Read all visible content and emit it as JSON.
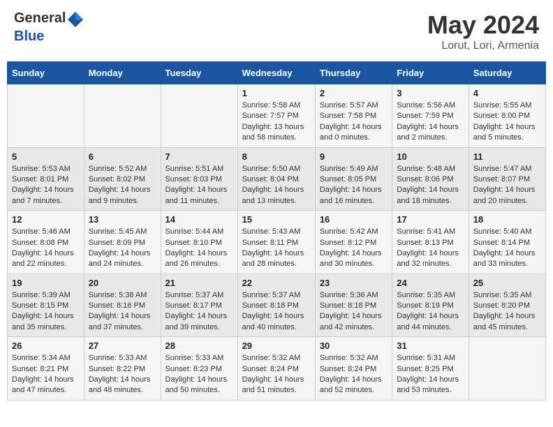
{
  "header": {
    "logo_general": "General",
    "logo_blue": "Blue",
    "title": "May 2024",
    "subtitle": "Lorut, Lori, Armenia"
  },
  "days_of_week": [
    "Sunday",
    "Monday",
    "Tuesday",
    "Wednesday",
    "Thursday",
    "Friday",
    "Saturday"
  ],
  "weeks": [
    {
      "days": [
        {
          "number": "",
          "sunrise": "",
          "sunset": "",
          "daylight": ""
        },
        {
          "number": "",
          "sunrise": "",
          "sunset": "",
          "daylight": ""
        },
        {
          "number": "",
          "sunrise": "",
          "sunset": "",
          "daylight": ""
        },
        {
          "number": "1",
          "sunrise": "Sunrise: 5:58 AM",
          "sunset": "Sunset: 7:57 PM",
          "daylight": "Daylight: 13 hours and 58 minutes."
        },
        {
          "number": "2",
          "sunrise": "Sunrise: 5:57 AM",
          "sunset": "Sunset: 7:58 PM",
          "daylight": "Daylight: 14 hours and 0 minutes."
        },
        {
          "number": "3",
          "sunrise": "Sunrise: 5:56 AM",
          "sunset": "Sunset: 7:59 PM",
          "daylight": "Daylight: 14 hours and 2 minutes."
        },
        {
          "number": "4",
          "sunrise": "Sunrise: 5:55 AM",
          "sunset": "Sunset: 8:00 PM",
          "daylight": "Daylight: 14 hours and 5 minutes."
        }
      ]
    },
    {
      "days": [
        {
          "number": "5",
          "sunrise": "Sunrise: 5:53 AM",
          "sunset": "Sunset: 8:01 PM",
          "daylight": "Daylight: 14 hours and 7 minutes."
        },
        {
          "number": "6",
          "sunrise": "Sunrise: 5:52 AM",
          "sunset": "Sunset: 8:02 PM",
          "daylight": "Daylight: 14 hours and 9 minutes."
        },
        {
          "number": "7",
          "sunrise": "Sunrise: 5:51 AM",
          "sunset": "Sunset: 8:03 PM",
          "daylight": "Daylight: 14 hours and 11 minutes."
        },
        {
          "number": "8",
          "sunrise": "Sunrise: 5:50 AM",
          "sunset": "Sunset: 8:04 PM",
          "daylight": "Daylight: 14 hours and 13 minutes."
        },
        {
          "number": "9",
          "sunrise": "Sunrise: 5:49 AM",
          "sunset": "Sunset: 8:05 PM",
          "daylight": "Daylight: 14 hours and 16 minutes."
        },
        {
          "number": "10",
          "sunrise": "Sunrise: 5:48 AM",
          "sunset": "Sunset: 8:06 PM",
          "daylight": "Daylight: 14 hours and 18 minutes."
        },
        {
          "number": "11",
          "sunrise": "Sunrise: 5:47 AM",
          "sunset": "Sunset: 8:07 PM",
          "daylight": "Daylight: 14 hours and 20 minutes."
        }
      ]
    },
    {
      "days": [
        {
          "number": "12",
          "sunrise": "Sunrise: 5:46 AM",
          "sunset": "Sunset: 8:08 PM",
          "daylight": "Daylight: 14 hours and 22 minutes."
        },
        {
          "number": "13",
          "sunrise": "Sunrise: 5:45 AM",
          "sunset": "Sunset: 8:09 PM",
          "daylight": "Daylight: 14 hours and 24 minutes."
        },
        {
          "number": "14",
          "sunrise": "Sunrise: 5:44 AM",
          "sunset": "Sunset: 8:10 PM",
          "daylight": "Daylight: 14 hours and 26 minutes."
        },
        {
          "number": "15",
          "sunrise": "Sunrise: 5:43 AM",
          "sunset": "Sunset: 8:11 PM",
          "daylight": "Daylight: 14 hours and 28 minutes."
        },
        {
          "number": "16",
          "sunrise": "Sunrise: 5:42 AM",
          "sunset": "Sunset: 8:12 PM",
          "daylight": "Daylight: 14 hours and 30 minutes."
        },
        {
          "number": "17",
          "sunrise": "Sunrise: 5:41 AM",
          "sunset": "Sunset: 8:13 PM",
          "daylight": "Daylight: 14 hours and 32 minutes."
        },
        {
          "number": "18",
          "sunrise": "Sunrise: 5:40 AM",
          "sunset": "Sunset: 8:14 PM",
          "daylight": "Daylight: 14 hours and 33 minutes."
        }
      ]
    },
    {
      "days": [
        {
          "number": "19",
          "sunrise": "Sunrise: 5:39 AM",
          "sunset": "Sunset: 8:15 PM",
          "daylight": "Daylight: 14 hours and 35 minutes."
        },
        {
          "number": "20",
          "sunrise": "Sunrise: 5:38 AM",
          "sunset": "Sunset: 8:16 PM",
          "daylight": "Daylight: 14 hours and 37 minutes."
        },
        {
          "number": "21",
          "sunrise": "Sunrise: 5:37 AM",
          "sunset": "Sunset: 8:17 PM",
          "daylight": "Daylight: 14 hours and 39 minutes."
        },
        {
          "number": "22",
          "sunrise": "Sunrise: 5:37 AM",
          "sunset": "Sunset: 8:18 PM",
          "daylight": "Daylight: 14 hours and 40 minutes."
        },
        {
          "number": "23",
          "sunrise": "Sunrise: 5:36 AM",
          "sunset": "Sunset: 8:18 PM",
          "daylight": "Daylight: 14 hours and 42 minutes."
        },
        {
          "number": "24",
          "sunrise": "Sunrise: 5:35 AM",
          "sunset": "Sunset: 8:19 PM",
          "daylight": "Daylight: 14 hours and 44 minutes."
        },
        {
          "number": "25",
          "sunrise": "Sunrise: 5:35 AM",
          "sunset": "Sunset: 8:20 PM",
          "daylight": "Daylight: 14 hours and 45 minutes."
        }
      ]
    },
    {
      "days": [
        {
          "number": "26",
          "sunrise": "Sunrise: 5:34 AM",
          "sunset": "Sunset: 8:21 PM",
          "daylight": "Daylight: 14 hours and 47 minutes."
        },
        {
          "number": "27",
          "sunrise": "Sunrise: 5:33 AM",
          "sunset": "Sunset: 8:22 PM",
          "daylight": "Daylight: 14 hours and 48 minutes."
        },
        {
          "number": "28",
          "sunrise": "Sunrise: 5:33 AM",
          "sunset": "Sunset: 8:23 PM",
          "daylight": "Daylight: 14 hours and 50 minutes."
        },
        {
          "number": "29",
          "sunrise": "Sunrise: 5:32 AM",
          "sunset": "Sunset: 8:24 PM",
          "daylight": "Daylight: 14 hours and 51 minutes."
        },
        {
          "number": "30",
          "sunrise": "Sunrise: 5:32 AM",
          "sunset": "Sunset: 8:24 PM",
          "daylight": "Daylight: 14 hours and 52 minutes."
        },
        {
          "number": "31",
          "sunrise": "Sunrise: 5:31 AM",
          "sunset": "Sunset: 8:25 PM",
          "daylight": "Daylight: 14 hours and 53 minutes."
        },
        {
          "number": "",
          "sunrise": "",
          "sunset": "",
          "daylight": ""
        }
      ]
    }
  ]
}
